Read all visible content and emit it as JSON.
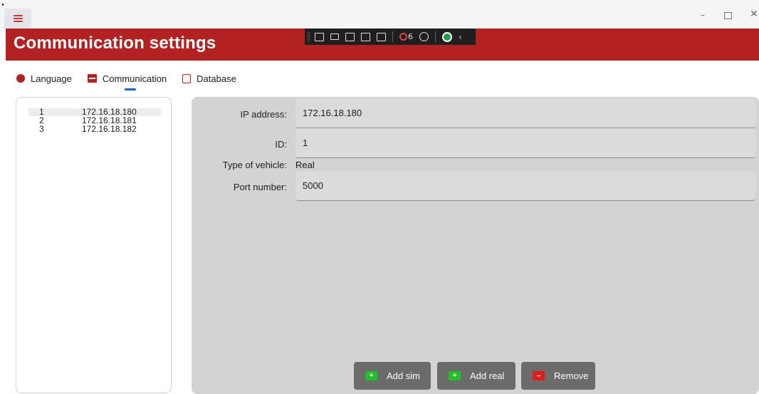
{
  "window": {
    "menu_icon": "hamburger-icon",
    "controls": {
      "minimize": "–",
      "maximize": "",
      "close": "✕"
    }
  },
  "header": {
    "title": "Communication settings",
    "color": "#b22222"
  },
  "devtools": {
    "icons": [
      "live-tree-icon",
      "record-icon",
      "select-element-icon",
      "display-layout-icon",
      "track-focus-icon",
      "binding-failures-icon",
      "accessibility-icon",
      "ok-status-icon",
      "collapse-chevron-icon"
    ],
    "binding_failures_count": "6",
    "chevron": "‹"
  },
  "tabs": [
    {
      "label": "Language",
      "icon": "globe-icon"
    },
    {
      "label": "Communication",
      "icon": "server-icon",
      "selected": true
    },
    {
      "label": "Database",
      "icon": "database-icon"
    }
  ],
  "accent_color": "#1467c4",
  "vehicles": {
    "selected_index": 0,
    "rows": [
      {
        "num": "1",
        "ip": "172.16.18.180"
      },
      {
        "num": "2",
        "ip": "172.16.18.181"
      },
      {
        "num": "3",
        "ip": "172.16.18.182"
      }
    ]
  },
  "details": {
    "ip_label": "IP address:",
    "ip_value": "172.16.18.180",
    "id_label": "ID:",
    "id_value": "1",
    "type_label": "Type of vehicle:",
    "type_value": "Real",
    "port_label": "Port number:",
    "port_value": "5000"
  },
  "buttons": {
    "add_sim": {
      "label": "Add sim",
      "icon": "add-icon"
    },
    "add_real": {
      "label": "Add real",
      "icon": "add-icon"
    },
    "remove": {
      "label": "Remove",
      "icon": "remove-icon"
    }
  }
}
